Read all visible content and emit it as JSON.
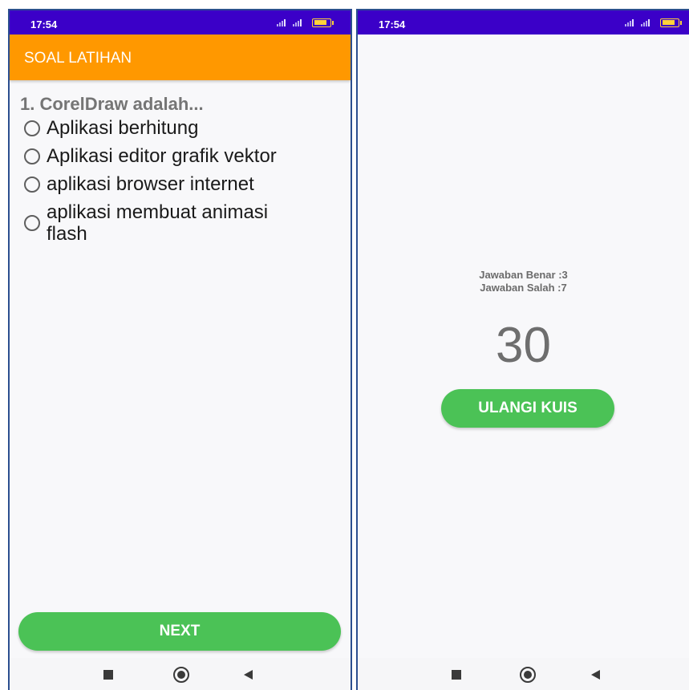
{
  "left_screen": {
    "status_bar": {
      "time": "17:54"
    },
    "app_bar": {
      "title": "SOAL LATIHAN"
    },
    "question": "1. CorelDraw adalah...",
    "options": [
      {
        "label": "Aplikasi berhitung"
      },
      {
        "label": "Aplikasi editor grafik vektor"
      },
      {
        "label": "aplikasi browser internet"
      },
      {
        "label": "aplikasi membuat animasi flash"
      }
    ],
    "next_label": "NEXT"
  },
  "right_screen": {
    "status_bar": {
      "time": "17:54"
    },
    "correct_text": "Jawaban Benar :3",
    "wrong_text": "Jawaban Salah :7",
    "score": "30",
    "retry_label": "ULANGI KUIS"
  },
  "colors": {
    "status_bar": "#3b00c8",
    "app_bar": "#ff9800",
    "button": "#4bc256",
    "background": "#f8f8fa"
  },
  "nav_icons": [
    "recents-square-icon",
    "home-circle-icon",
    "back-triangle-icon"
  ]
}
